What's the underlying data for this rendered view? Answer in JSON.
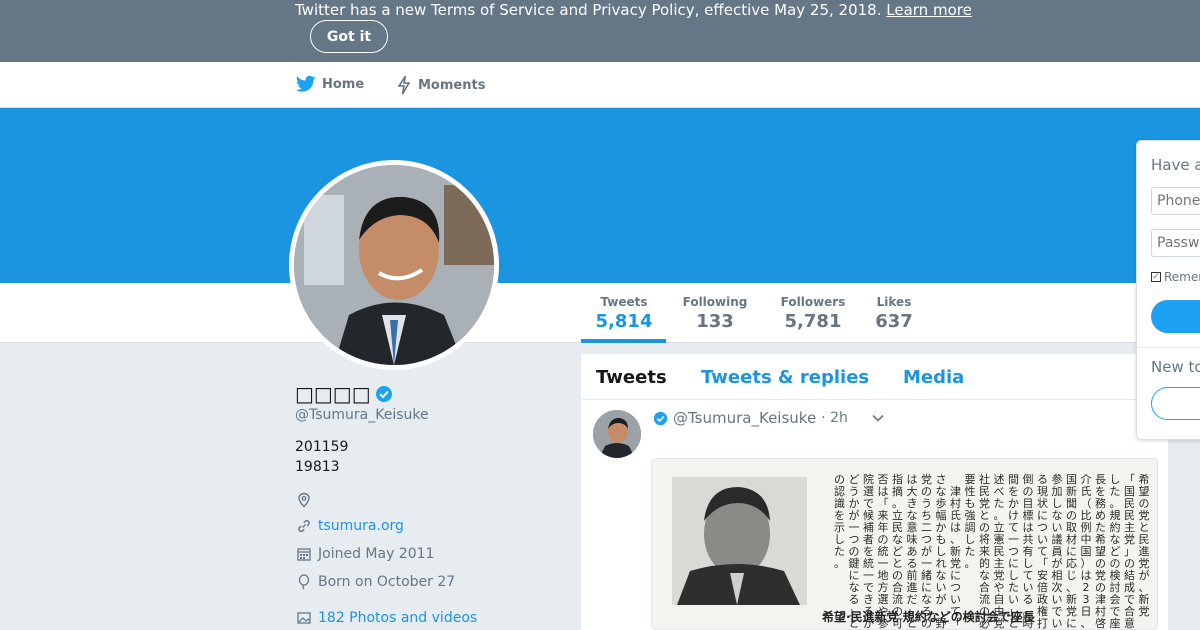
{
  "banner": {
    "text": "Twitter has a new Terms of Service and Privacy Policy, effective May 25, 2018.",
    "learn_more": "Learn more",
    "got_it": "Got it"
  },
  "nav": {
    "home": "Home",
    "moments": "Moments"
  },
  "stats": {
    "tweets_label": "Tweets",
    "tweets_value": "5,814",
    "following_label": "Following",
    "following_value": "133",
    "followers_label": "Followers",
    "followers_value": "5,781",
    "likes_label": "Likes",
    "likes_value": "637"
  },
  "profile": {
    "name": "□□□□",
    "handle": "@Tsumura_Keisuke",
    "bio_line1": "201159",
    "bio_line2": "19813",
    "website": "tsumura.org",
    "joined": "Joined May 2011",
    "born": "Born on October 27",
    "photos": "182 Photos and videos"
  },
  "timeline": {
    "tabs": [
      "Tweets",
      "Tweets & replies",
      "Media"
    ],
    "tweet_handle": "@Tsumura_Keisuke",
    "tweet_time": "· 2h"
  },
  "newspaper": {
    "headline": "希望·民進新党 規約などの検討会で座長",
    "columns": [
      "希望の党と民進党が、新党",
      "「国民民主党」の結成で合意",
      "した。規約などの検討会で座",
      "長を務めた希望の党の津村啓",
      "介氏（比例中国）は23日、中",
      "国新聞の取材に応じ、新党に",
      "参加しない議員が相次いでい",
      "る現状について「安倍政権打",
      "倒の目標は共有している。時",
      "間をかけて一つにしたい」と",
      "述べた。立憲民主党や自由党、",
      "社民党との将来的な合流の必",
      "要性も強調した。",
      "　津村氏は、新党について「小",
      "さな歩幅かもしれないが、野",
      "党のうち二つが一緒になるの",
      "は大きな意味ある前進だ」と",
      "指摘。立民などとの合流の可",
      "否は「来年の統一地方選や参",
      "院選で候補者を統一できるか",
      "どうかが一つの鍵になる」と",
      "の認識を示した。"
    ]
  },
  "login": {
    "title": "Have an account?",
    "phone_placeholder": "Phone, email, or username",
    "password_placeholder": "Password",
    "remember": "Remember me",
    "new_to": "New to Twitter?"
  },
  "colors": {
    "accent": "#1b95e0",
    "banner": "#657786",
    "background": "#e6ecf0"
  }
}
